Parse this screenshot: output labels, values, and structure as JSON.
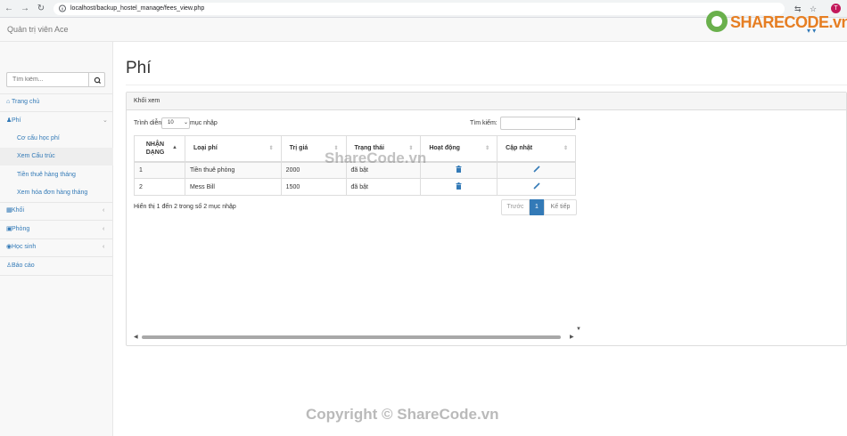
{
  "browser": {
    "url": "localhost/backup_hostel_manage/fees_view.php",
    "profile_initial": "T"
  },
  "navbar": {
    "brand": "Quản trị viên Ace"
  },
  "sidebar": {
    "search_placeholder": "Tìm kiếm...",
    "items": [
      {
        "label": "Trang chủ",
        "icon": "home-icon"
      },
      {
        "label": "Phí",
        "icon": "users-icon",
        "expanded": true
      },
      {
        "label": "Khối",
        "icon": "building-icon"
      },
      {
        "label": "Phòng",
        "icon": "bed-icon"
      },
      {
        "label": "Học sinh",
        "icon": "user-circle-icon"
      },
      {
        "label": "Báo cáo",
        "icon": "person-icon"
      }
    ],
    "subitems": [
      {
        "label": "Cơ cấu học phí"
      },
      {
        "label": "Xem Cấu trúc",
        "active": true
      },
      {
        "label": "Tiền thuê hàng tháng"
      },
      {
        "label": "Xem hóa đơn hàng tháng"
      }
    ]
  },
  "main": {
    "title": "Phí",
    "panel_heading": "Khối xem",
    "length_prefix": "Trình diễn",
    "length_value": "10",
    "length_suffix": "mục nhập",
    "filter_label": "Tìm kiếm:",
    "columns": [
      "NHẬN DẠNG",
      "Loại phí",
      "Trị giá",
      "Trạng thái",
      "Hoạt động",
      "Cập nhật"
    ],
    "rows": [
      {
        "id": "1",
        "type": "Tiền thuê phòng",
        "value": "2000",
        "status": "đã bật"
      },
      {
        "id": "2",
        "type": "Mess Bill",
        "value": "1500",
        "status": "đã bật"
      }
    ],
    "info": "Hiển thị 1 đến 2 trong số 2 mục nhập",
    "pager": {
      "prev": "Trước",
      "current": "1",
      "next": "Kế tiếp"
    }
  },
  "watermarks": {
    "logo_text": "SHARECODE.vn",
    "center": "ShareCode.vn",
    "copyright": "Copyright © ShareCode.vn"
  }
}
